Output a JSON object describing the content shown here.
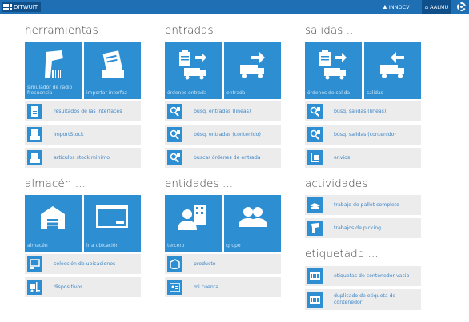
{
  "topbar": {
    "brand": "DITWUIT",
    "user": "INNOCV",
    "home": "AALMU"
  },
  "herramientas": {
    "title": "herramientas",
    "tiles": [
      "simulador de radio frecuencia",
      "importar interfaz"
    ],
    "rows": [
      "resultados de las interfaces",
      "importStock",
      "articulos stock minimo"
    ]
  },
  "entradas": {
    "title": "entradas",
    "tiles": [
      "órdenes entrada",
      "entrada"
    ],
    "rows": [
      "búsq. entradas (lineas)",
      "búsq. entradas (contenido)",
      "buscar órdenes de entrada"
    ]
  },
  "salidas": {
    "title": "salidas ...",
    "tiles": [
      "órdenes de salida",
      "salidas"
    ],
    "rows": [
      "búsq. salidas (lineas)",
      "búsq. salidas (contenido)",
      "envios"
    ]
  },
  "almacen": {
    "title": "almacén ...",
    "tiles": [
      "almacén",
      "ir a ubicación"
    ],
    "rows": [
      "colección de ubicaciones",
      "dispositivos"
    ]
  },
  "entidades": {
    "title": "entidades ...",
    "tiles": [
      "tercero",
      "grupo"
    ],
    "rows": [
      "producto",
      "mi cuenta"
    ]
  },
  "actividades": {
    "title": "actividades",
    "rows": [
      "trabajo de pallet completo",
      "trabajos de picking"
    ]
  },
  "etiquetado": {
    "title": "etiquetado ...",
    "rows": [
      "etiquetas de contenedor vacio",
      "duplicado de etiqueta de contenedor"
    ]
  }
}
